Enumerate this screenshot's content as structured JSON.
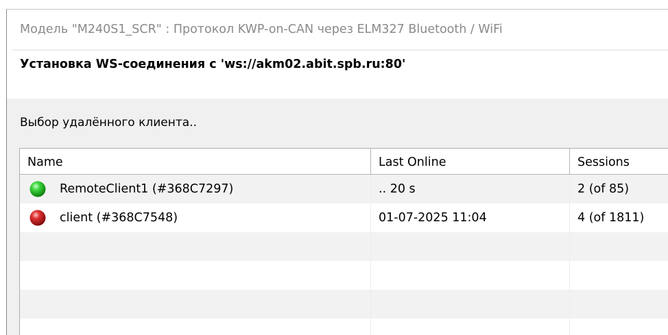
{
  "window": {
    "title": "Модель \"M240S1_SCR\" : Протокол KWP-on-CAN через ELM327 Bluetooth / WiFi",
    "status": "Установка WS-соединения с 'ws://akm02.abit.spb.ru:80'"
  },
  "prompt": "Выбор удалённого клиента..",
  "client_list": {
    "columns": [
      "Name",
      "Last Online",
      "Sessions"
    ],
    "rows": [
      {
        "status": "online",
        "status_icon": "green-status-icon",
        "status_color": "#1db81d",
        "name": "RemoteClient1 (#368C7297)",
        "last_online": "..  20 s",
        "sessions": "2 (of 85)"
      },
      {
        "status": "offline",
        "status_icon": "red-status-icon",
        "status_color": "#d41b1b",
        "name": "client (#368C7548)",
        "last_online": "01-07-2025 11:04",
        "sessions": "4 (of 1811)"
      }
    ]
  },
  "colors": {
    "accent_online": "#1db81d",
    "accent_offline": "#d41b1b"
  }
}
